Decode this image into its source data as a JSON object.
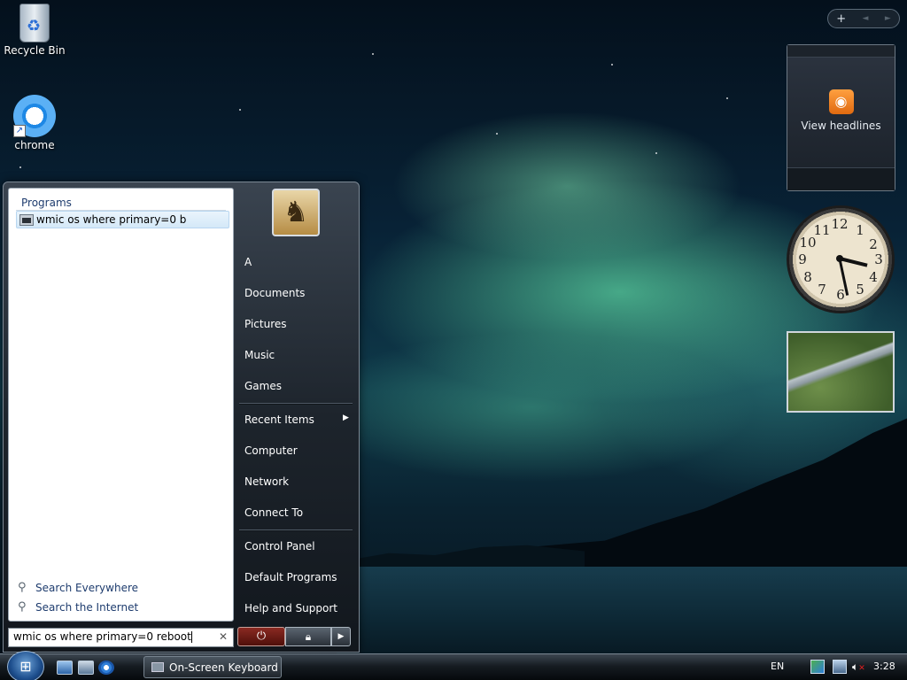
{
  "desktop": {
    "icons": [
      {
        "label": "Recycle Bin",
        "icon": "recycle-bin-icon"
      },
      {
        "label": "chrome",
        "icon": "chrome-icon"
      }
    ]
  },
  "gadgets": {
    "toolbar": {
      "add": "+",
      "prev": "◄",
      "next": "►"
    },
    "news": {
      "label": "View headlines",
      "icon": "rss-icon"
    },
    "clock": {
      "numbers": [
        "12",
        "1",
        "2",
        "3",
        "4",
        "5",
        "6",
        "7",
        "8",
        "9",
        "10",
        "11"
      ],
      "hour": 3,
      "minute": 28
    },
    "slideshow": {
      "icon": "photo-icon"
    }
  },
  "start_menu": {
    "programs_header": "Programs",
    "program_results": [
      {
        "label": "wmic os where primary=0 b",
        "icon": "command-prompt-icon"
      }
    ],
    "search_everywhere": "Search Everywhere",
    "search_internet": "Search the Internet",
    "search_value": "wmic os where primary=0 reboot",
    "right_items": [
      {
        "label": "A"
      },
      {
        "label": "Documents"
      },
      {
        "label": "Pictures"
      },
      {
        "label": "Music"
      },
      {
        "label": "Games"
      },
      {
        "label": "Recent Items"
      },
      {
        "label": "Computer"
      },
      {
        "label": "Network"
      },
      {
        "label": "Connect To"
      },
      {
        "label": "Control Panel"
      },
      {
        "label": "Default Programs"
      },
      {
        "label": "Help and Support"
      }
    ],
    "power_icon": "power-icon",
    "lock_icon": "lock-icon"
  },
  "taskbar": {
    "active_task": "On-Screen Keyboard",
    "language": "EN",
    "time": "3:28"
  }
}
